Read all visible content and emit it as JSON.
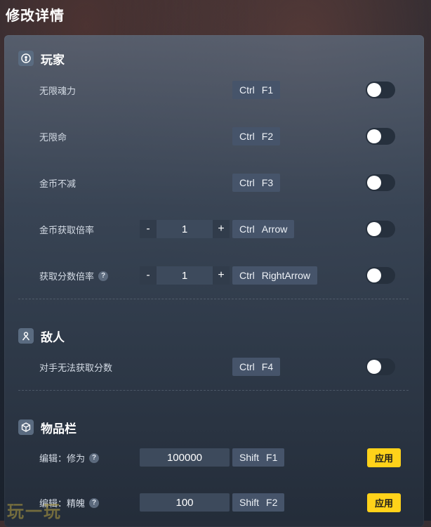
{
  "page": {
    "title": "修改详情"
  },
  "sections": {
    "player": {
      "title": "玩家",
      "rows": [
        {
          "label": "无限魂力",
          "key1": "Ctrl",
          "key2": "F1"
        },
        {
          "label": "无限命",
          "key1": "Ctrl",
          "key2": "F2"
        },
        {
          "label": "金币不减",
          "key1": "Ctrl",
          "key2": "F3"
        },
        {
          "label": "金币获取倍率",
          "stepper": {
            "minus": "-",
            "value": "1",
            "plus": "+"
          },
          "key1": "Ctrl",
          "key2": "Arrow"
        },
        {
          "label": "获取分数倍率",
          "help": "?",
          "stepper": {
            "minus": "-",
            "value": "1",
            "plus": "+"
          },
          "key1": "Ctrl",
          "key2": "RightArrow"
        }
      ]
    },
    "enemy": {
      "title": "敌人",
      "rows": [
        {
          "label": "对手无法获取分数",
          "key1": "Ctrl",
          "key2": "F4"
        }
      ]
    },
    "inventory": {
      "title": "物品栏",
      "rows": [
        {
          "label": "编辑：修为",
          "help": "?",
          "value": "100000",
          "key1": "Shift",
          "key2": "F1",
          "apply": "应用"
        },
        {
          "label": "编辑：精魄",
          "help": "?",
          "value": "100",
          "key1": "Shift",
          "key2": "F2",
          "apply": "应用"
        }
      ]
    }
  },
  "toggles": {
    "state": "off"
  },
  "colors": {
    "apply_button": "#ffd21a",
    "panel": "#3a4758",
    "hotkey_bg": "#46546a"
  },
  "watermark": "玩一玩"
}
